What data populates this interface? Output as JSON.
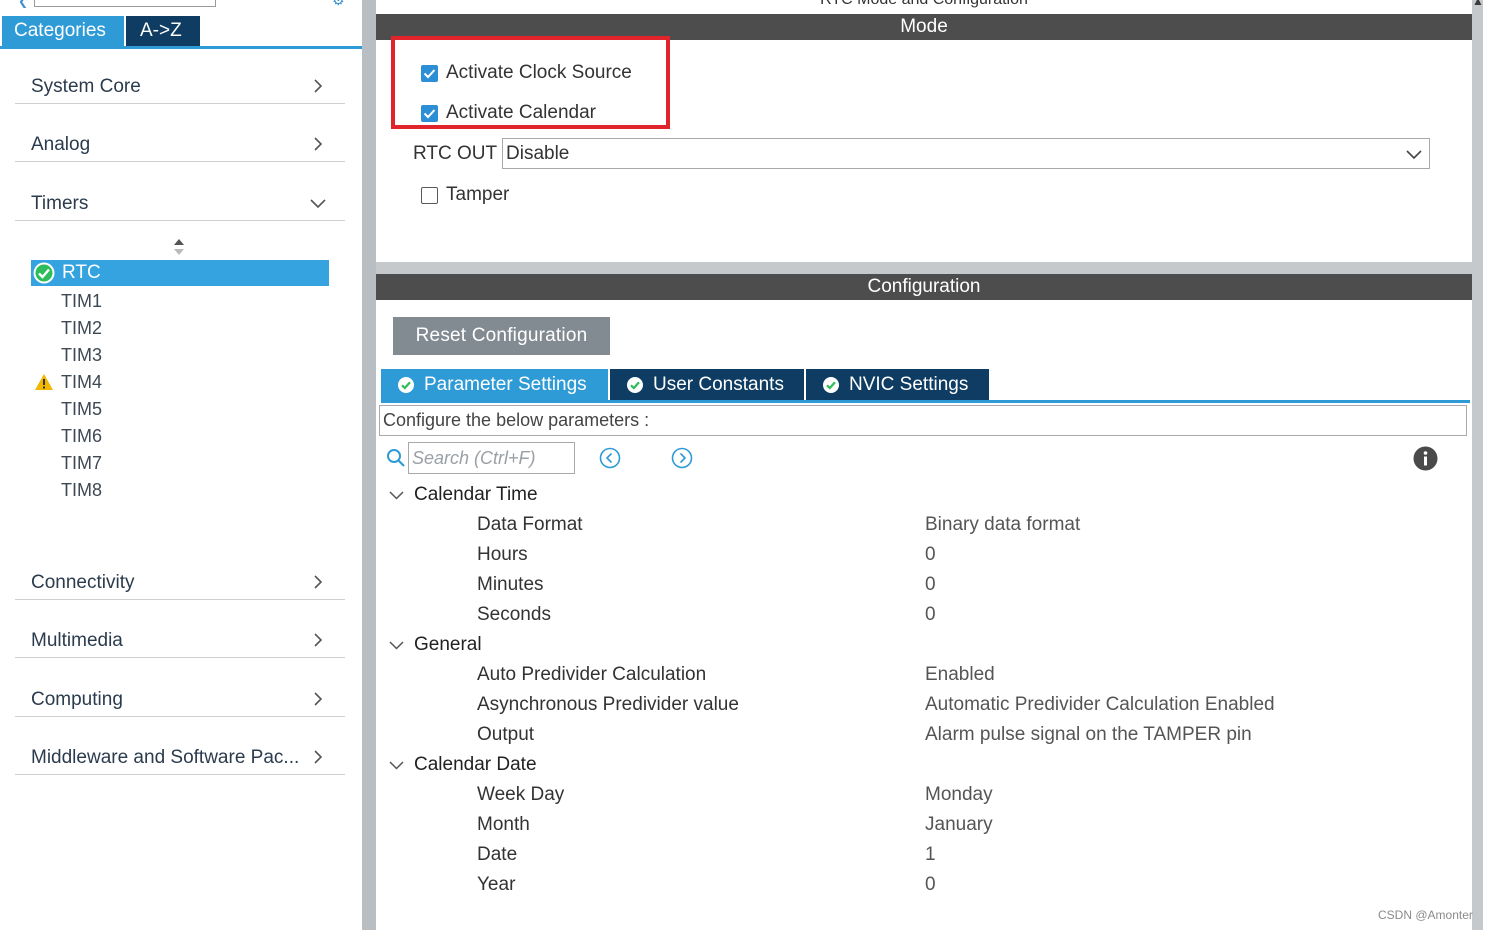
{
  "mode_title": "RTC Mode and Configuration",
  "view_tabs": {
    "categories": "Categories",
    "az": "A->Z"
  },
  "categories": {
    "system_core": "System Core",
    "analog": "Analog",
    "timers": "Timers",
    "connectivity": "Connectivity",
    "multimedia": "Multimedia",
    "computing": "Computing",
    "middleware": "Middleware and Software Pac..."
  },
  "timers_items": [
    "RTC",
    "TIM1",
    "TIM2",
    "TIM3",
    "TIM4",
    "TIM5",
    "TIM6",
    "TIM7",
    "TIM8"
  ],
  "mode": {
    "header": "Mode",
    "activate_clock_source": "Activate Clock Source",
    "activate_calendar": "Activate Calendar",
    "rtc_out_label": "RTC OUT",
    "rtc_out_value": "Disable",
    "tamper": "Tamper"
  },
  "configuration": {
    "header": "Configuration",
    "reset_button": "Reset Configuration",
    "tabs": [
      "Parameter Settings",
      "User Constants",
      "NVIC Settings"
    ],
    "description": "Configure the below parameters :",
    "search_placeholder": "Search (Ctrl+F)"
  },
  "params": {
    "calendar_time": {
      "label": "Calendar Time",
      "rows": [
        {
          "name": "Data Format",
          "value": "Binary data format"
        },
        {
          "name": "Hours",
          "value": "0"
        },
        {
          "name": "Minutes",
          "value": "0"
        },
        {
          "name": "Seconds",
          "value": "0"
        }
      ]
    },
    "general": {
      "label": "General",
      "rows": [
        {
          "name": "Auto Predivider Calculation",
          "value": "Enabled"
        },
        {
          "name": "Asynchronous Predivider value",
          "value": "Automatic Predivider Calculation Enabled"
        },
        {
          "name": "Output",
          "value": "Alarm pulse signal on the TAMPER pin"
        }
      ]
    },
    "calendar_date": {
      "label": "Calendar Date",
      "rows": [
        {
          "name": "Week Day",
          "value": "Monday"
        },
        {
          "name": "Month",
          "value": "January"
        },
        {
          "name": "Date",
          "value": "1"
        },
        {
          "name": "Year",
          "value": "0"
        }
      ]
    }
  },
  "watermark": "CSDN @Amonter",
  "colors": {
    "accent_blue": "#2e9ad6",
    "dark_navy": "#0f3c62",
    "header_gray": "#4d4d4d",
    "highlight_red": "#e1232b",
    "check_green": "#2dbd5a",
    "warning_yellow": "#f2b700"
  }
}
